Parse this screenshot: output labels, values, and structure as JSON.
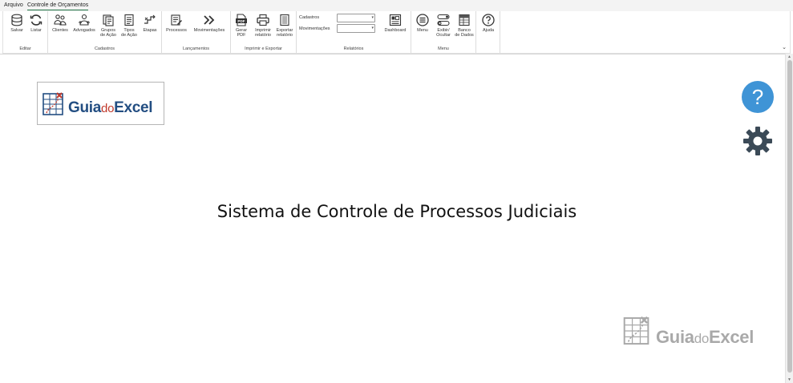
{
  "menubar": {
    "tabs": [
      {
        "label": "Arquivo"
      },
      {
        "label": "Controle de Orçamentos"
      }
    ]
  },
  "ribbon": {
    "groups": {
      "editar": {
        "label": "Editar",
        "buttons": [
          {
            "label": "Salvar",
            "icon": "database-icon"
          },
          {
            "label": "Listar",
            "icon": "refresh-icon"
          }
        ]
      },
      "cadastros": {
        "label": "Cadastros",
        "buttons": [
          {
            "label": "Clientes",
            "icon": "clients-icon"
          },
          {
            "label": "Advogados",
            "icon": "lawyers-icon"
          },
          {
            "label": "Grupos de Ação",
            "line1": "Grupos",
            "line2": "de Ação",
            "icon": "groups-icon"
          },
          {
            "label": "Tipos de Ação",
            "line1": "Tipos",
            "line2": "de Ação",
            "icon": "types-icon"
          },
          {
            "label": "Etapas",
            "icon": "steps-icon"
          }
        ]
      },
      "lancamentos": {
        "label": "Lançamentos",
        "buttons": [
          {
            "label": "Processos",
            "icon": "process-icon"
          },
          {
            "label": "Movimentações",
            "icon": "double-chevron-icon"
          }
        ]
      },
      "imprimir": {
        "label": "Imprimir e Exportar",
        "buttons": [
          {
            "line1": "Gerar",
            "line2": "PDF",
            "icon": "pdf-icon"
          },
          {
            "line1": "Imprimir",
            "line2": "relatório",
            "icon": "printer-icon"
          },
          {
            "line1": "Exportar",
            "line2": "relatório",
            "icon": "export-icon"
          }
        ]
      },
      "relatorios": {
        "label": "Relatórios",
        "combo1_label": "Cadastros",
        "combo2_label": "Movimentações",
        "buttons": [
          {
            "label": "Dashboard",
            "icon": "dashboard-icon"
          }
        ]
      },
      "menu": {
        "label": "Menu",
        "buttons": [
          {
            "label": "Menu",
            "icon": "menu-icon"
          },
          {
            "line1": "Exibir/",
            "line2": "Ocultar",
            "icon": "toggle-icon"
          },
          {
            "line1": "Banco",
            "line2": "de Dados",
            "icon": "database-table-icon"
          }
        ]
      },
      "ajuda": {
        "buttons": [
          {
            "label": "Ajuda",
            "icon": "help-icon"
          }
        ]
      }
    }
  },
  "content": {
    "logo": {
      "brand_main": "Guia",
      "brand_do": "do",
      "brand_end": "Excel"
    },
    "title": "Sistema de Controle de Processos Judiciais",
    "help_symbol": "?",
    "watermark": {
      "brand_main": "Guia",
      "brand_do": "do",
      "brand_end": "Excel"
    }
  },
  "colors": {
    "accent": "#217346",
    "help_blue": "#3f94d6",
    "gear": "#3b4a57",
    "brand_blue": "#234e82",
    "brand_red": "#c0392b"
  }
}
